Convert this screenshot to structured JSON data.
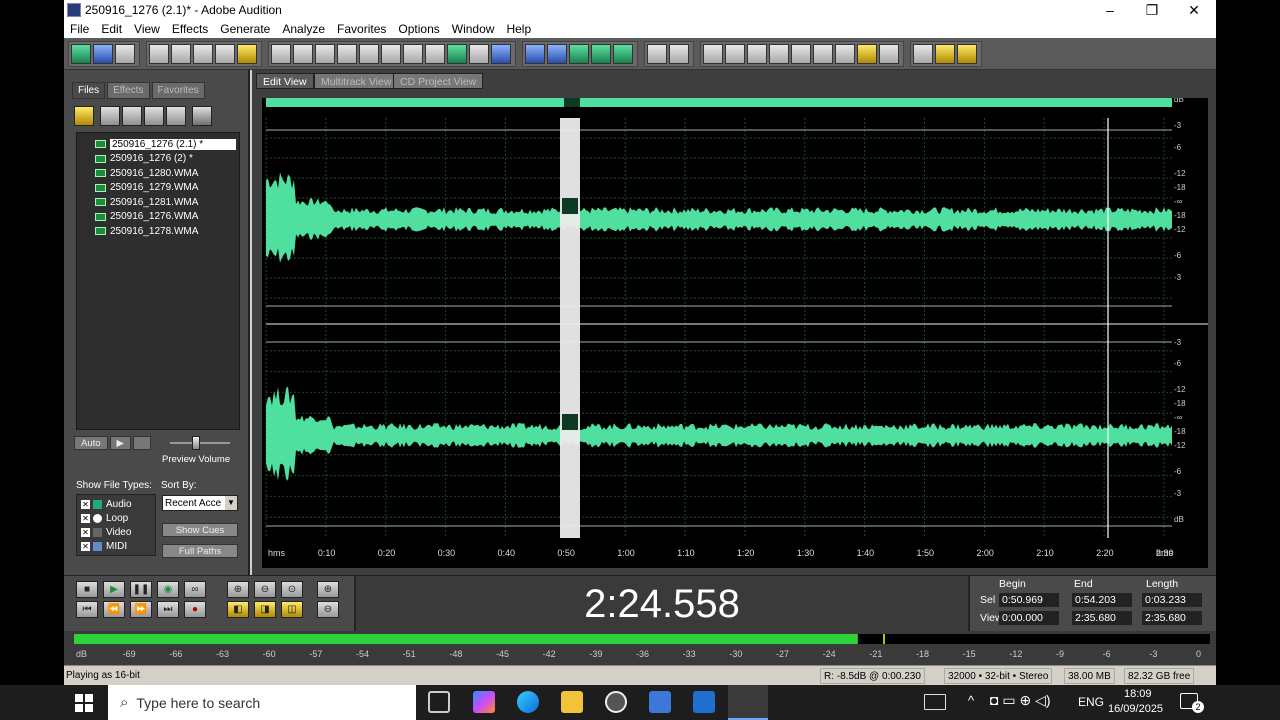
{
  "window": {
    "title": "250916_1276 (2.1)* - Adobe Audition",
    "minimize": "–",
    "maximize": "❐",
    "close": "✕"
  },
  "menu": [
    "File",
    "Edit",
    "View",
    "Effects",
    "Generate",
    "Analyze",
    "Favorites",
    "Options",
    "Window",
    "Help"
  ],
  "left_panel": {
    "tabs": [
      "Files",
      "Effects",
      "Favorites"
    ],
    "files": [
      "250916_1276 (2.1) *",
      "250916_1276 (2) *",
      "250916_1280.WMA",
      "250916_1279.WMA",
      "250916_1281.WMA",
      "250916_1276.WMA",
      "250916_1278.WMA"
    ],
    "auto_label": "Auto",
    "play_glyph": "▶",
    "preview_label": "Preview Volume",
    "show_file_types_label": "Show File Types:",
    "file_types": [
      "Audio",
      "Loop",
      "Video",
      "MIDI"
    ],
    "sort_by_label": "Sort By:",
    "sort_value": "Recent Acce",
    "show_cues": "Show Cues",
    "full_paths": "Full Paths"
  },
  "views": {
    "tabs": [
      "Edit View",
      "Multitrack View",
      "CD Project View"
    ],
    "active": "Edit View"
  },
  "waveform": {
    "time_ticks": [
      "hms",
      "0:10",
      "0:20",
      "0:30",
      "0:40",
      "0:50",
      "1:00",
      "1:10",
      "1:20",
      "1:30",
      "1:40",
      "1:50",
      "2:00",
      "2:10",
      "2:20",
      "2:30",
      "hms"
    ],
    "db_ticks_top": [
      "dB",
      "-3",
      "-6",
      "-12",
      "-18",
      "-∞",
      "-18",
      "-12",
      "-6",
      "-3"
    ],
    "db_ticks_bottom": [
      "-3",
      "-6",
      "-12",
      "-18",
      "-∞",
      "-18",
      "-12",
      "-6",
      "-3",
      "dB"
    ],
    "wave_color": "#4fe0a0"
  },
  "transport": {
    "time": "2:24.558",
    "columns": [
      "Begin",
      "End",
      "Length"
    ],
    "rows": [
      {
        "label": "Sel",
        "begin": "0:50.969",
        "end": "0:54.203",
        "length": "0:03.233"
      },
      {
        "label": "View",
        "begin": "0:00.000",
        "end": "2:35.680",
        "length": "2:35.680"
      }
    ]
  },
  "meter": {
    "ticks": [
      "dB",
      "-69",
      "-66",
      "-63",
      "-60",
      "-57",
      "-54",
      "-51",
      "-48",
      "-45",
      "-42",
      "-39",
      "-36",
      "-33",
      "-30",
      "-27",
      "-24",
      "-21",
      "-18",
      "-15",
      "-12",
      "-9",
      "-6",
      "-3",
      "0"
    ],
    "level_fraction": 0.69
  },
  "status": {
    "left": "Playing as 16-bit",
    "rinfo": "R: -8.5dB @   0:00.230",
    "format": "32000 • 32-bit • Stereo",
    "size": "38.00 MB",
    "free": "82.32 GB free"
  },
  "taskbar": {
    "search_placeholder": "Type here to search",
    "lang": "ENG",
    "time": "18:09",
    "date": "16/09/2025",
    "notif": "2"
  }
}
